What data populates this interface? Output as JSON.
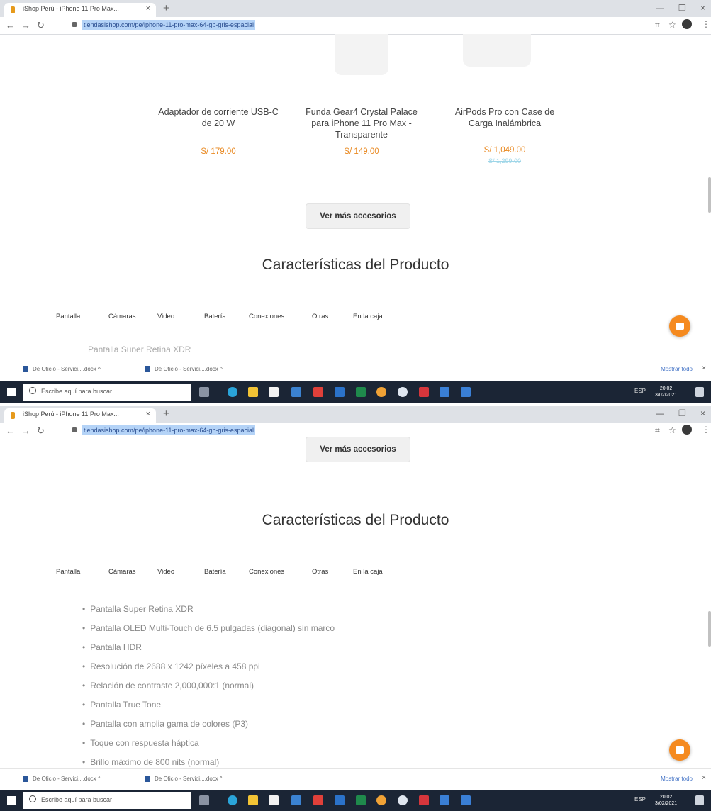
{
  "browser": {
    "tab_title": "iShop Perú - iPhone 11 Pro Max...",
    "url": "tiendasishop.com/pe/iphone-11-pro-max-64-gb-gris-espacial"
  },
  "accessories": {
    "products": [
      {
        "name": "Adaptador de corriente USB-C de 20 W",
        "price": "S/ 179.00",
        "old_price": ""
      },
      {
        "name": "Funda Gear4 Crystal Palace para iPhone 11 Pro Max - Transparente",
        "price": "S/ 149.00",
        "old_price": ""
      },
      {
        "name": "AirPods Pro con Case de Carga Inalámbrica",
        "price": "S/ 1,049.00",
        "old_price": "S/ 1,299.00"
      }
    ],
    "more_button": "Ver más accesorios"
  },
  "features": {
    "title": "Características del Producto",
    "tabs": [
      "Pantalla",
      "Cámaras",
      "Video",
      "Batería",
      "Conexiones",
      "Otras",
      "En la caja"
    ],
    "active_tab": "Pantalla",
    "items": [
      "Pantalla Super Retina XDR",
      "Pantalla OLED Multi-Touch de 6.5 pulgadas (diagonal) sin marco",
      "Pantalla HDR",
      "Resolución de 2688 x 1242 píxeles a 458 ppi",
      "Relación de contraste 2,000,000:1 (normal)",
      "Pantalla True Tone",
      "Pantalla con amplia gama de colores (P3)",
      "Toque con respuesta háptica",
      "Brillo máximo de 800 nits (normal)"
    ]
  },
  "downloads": {
    "items": [
      "De Oficio - Servici....docx",
      "De Oficio - Servici....docx"
    ],
    "show_all": "Mostrar todo"
  },
  "taskbar": {
    "search_placeholder": "Escribe aquí para buscar",
    "language": "ESP",
    "time": "20:02",
    "date": "3/02/2021"
  }
}
